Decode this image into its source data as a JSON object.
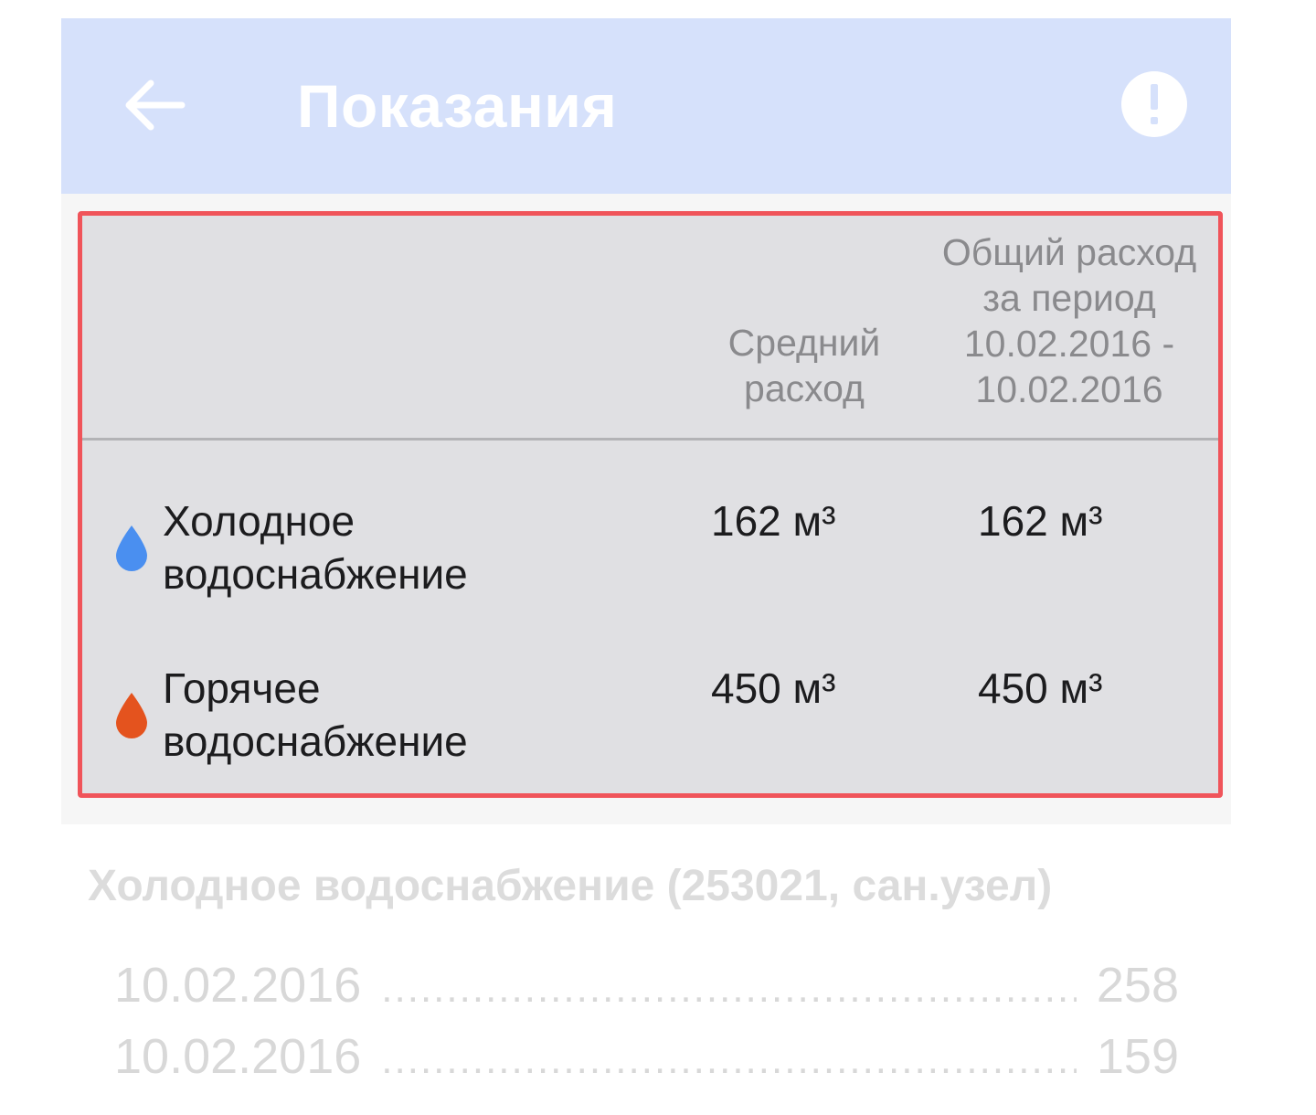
{
  "appbar": {
    "title": "Показания",
    "back_icon": "arrow-left-icon",
    "info_icon": "alert-circle-icon",
    "background": "#d6e1fb"
  },
  "summary": {
    "columns": {
      "avg": [
        "Средний",
        "расход"
      ],
      "total": [
        "Общий расход",
        "за период",
        "10.02.2016 -",
        "10.02.2016"
      ]
    },
    "rows": [
      {
        "label": [
          "Холодное",
          "водоснабжение"
        ],
        "icon": "water-drop-icon",
        "icon_color": "#4a8ff0",
        "avg": "162 м³",
        "total": "162 м³"
      },
      {
        "label": [
          "Горячее",
          "водоснабжение"
        ],
        "icon": "water-drop-icon",
        "icon_color": "#e4531e",
        "avg": "450 м³",
        "total": "450 м³"
      }
    ],
    "highlight_color": "#f0545a"
  },
  "meter": {
    "title": "Холодное водоснабжение (253021, сан.узел)",
    "readings": [
      {
        "date": "10.02.2016",
        "value": "258"
      },
      {
        "date": "10.02.2016",
        "value": "159"
      }
    ]
  }
}
